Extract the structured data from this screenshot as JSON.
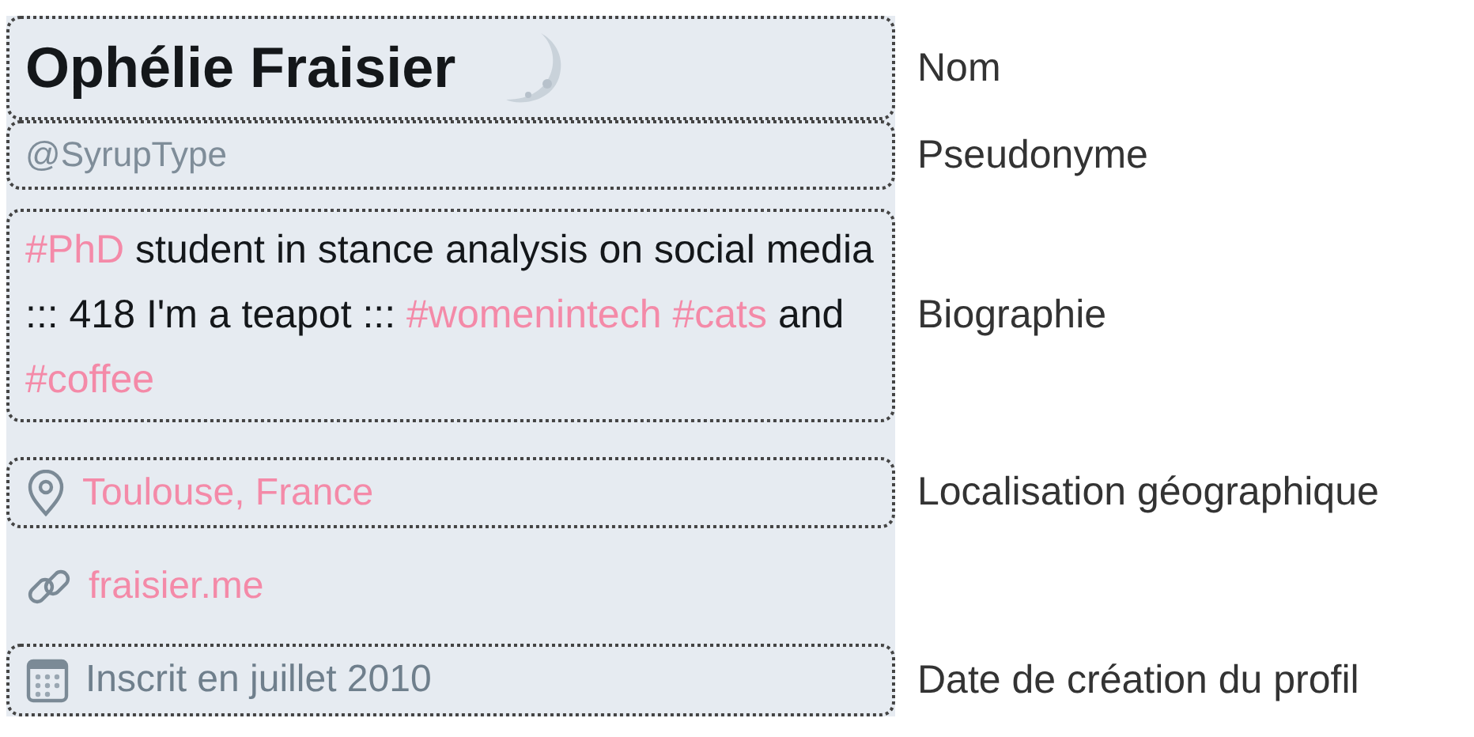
{
  "profile": {
    "fields": [
      {
        "kind": "name",
        "text": "Ophélie Fraisier",
        "annotation": "Nom"
      },
      {
        "kind": "handle",
        "text": "@SyrupType",
        "annotation": "Pseudonyme"
      },
      {
        "kind": "bio",
        "segments": [
          {
            "kind": "hashtag",
            "text": "#PhD"
          },
          {
            "kind": "plain",
            "text": " student in stance analysis on social media ::: 418 I'm a teapot ::: "
          },
          {
            "kind": "hashtag",
            "text": "#womenintech"
          },
          {
            "kind": "hashtag",
            "text": "#cats"
          },
          {
            "kind": "plain",
            "text": " and "
          },
          {
            "kind": "hashtag",
            "text": "#coffee"
          }
        ],
        "annotation": "Biographie"
      },
      {
        "kind": "location",
        "text": "Toulouse, France",
        "annotation": "Localisation géographique"
      },
      {
        "kind": "link",
        "text": "fraisier.me"
      },
      {
        "kind": "joined",
        "text": "Inscrit en juillet 2010",
        "annotation": "Date de création du profil"
      }
    ]
  }
}
